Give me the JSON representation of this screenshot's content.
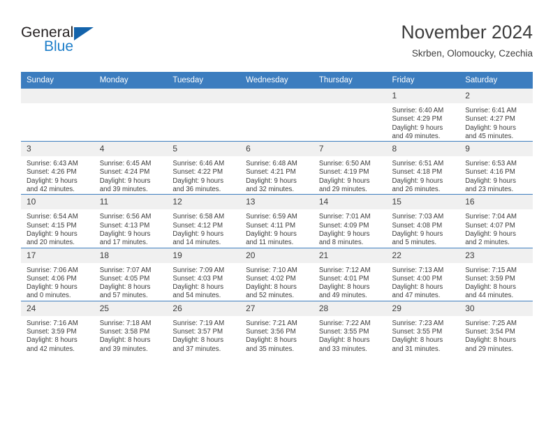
{
  "brand": {
    "name_part1": "General",
    "name_part2": "Blue"
  },
  "header": {
    "title": "November 2024",
    "subtitle": "Skrben, Olomoucky, Czechia"
  },
  "colors": {
    "header_blue": "#3c7dbf",
    "daynum_gray": "#f0f0f0",
    "logo_blue": "#1d7ec9",
    "text": "#3c3c3c"
  },
  "weekdays": [
    "Sunday",
    "Monday",
    "Tuesday",
    "Wednesday",
    "Thursday",
    "Friday",
    "Saturday"
  ],
  "weeks": [
    [
      {
        "day": "",
        "lines": []
      },
      {
        "day": "",
        "lines": []
      },
      {
        "day": "",
        "lines": []
      },
      {
        "day": "",
        "lines": []
      },
      {
        "day": "",
        "lines": []
      },
      {
        "day": "1",
        "lines": [
          "Sunrise: 6:40 AM",
          "Sunset: 4:29 PM",
          "Daylight: 9 hours",
          "and 49 minutes."
        ]
      },
      {
        "day": "2",
        "lines": [
          "Sunrise: 6:41 AM",
          "Sunset: 4:27 PM",
          "Daylight: 9 hours",
          "and 45 minutes."
        ]
      }
    ],
    [
      {
        "day": "3",
        "lines": [
          "Sunrise: 6:43 AM",
          "Sunset: 4:26 PM",
          "Daylight: 9 hours",
          "and 42 minutes."
        ]
      },
      {
        "day": "4",
        "lines": [
          "Sunrise: 6:45 AM",
          "Sunset: 4:24 PM",
          "Daylight: 9 hours",
          "and 39 minutes."
        ]
      },
      {
        "day": "5",
        "lines": [
          "Sunrise: 6:46 AM",
          "Sunset: 4:22 PM",
          "Daylight: 9 hours",
          "and 36 minutes."
        ]
      },
      {
        "day": "6",
        "lines": [
          "Sunrise: 6:48 AM",
          "Sunset: 4:21 PM",
          "Daylight: 9 hours",
          "and 32 minutes."
        ]
      },
      {
        "day": "7",
        "lines": [
          "Sunrise: 6:50 AM",
          "Sunset: 4:19 PM",
          "Daylight: 9 hours",
          "and 29 minutes."
        ]
      },
      {
        "day": "8",
        "lines": [
          "Sunrise: 6:51 AM",
          "Sunset: 4:18 PM",
          "Daylight: 9 hours",
          "and 26 minutes."
        ]
      },
      {
        "day": "9",
        "lines": [
          "Sunrise: 6:53 AM",
          "Sunset: 4:16 PM",
          "Daylight: 9 hours",
          "and 23 minutes."
        ]
      }
    ],
    [
      {
        "day": "10",
        "lines": [
          "Sunrise: 6:54 AM",
          "Sunset: 4:15 PM",
          "Daylight: 9 hours",
          "and 20 minutes."
        ]
      },
      {
        "day": "11",
        "lines": [
          "Sunrise: 6:56 AM",
          "Sunset: 4:13 PM",
          "Daylight: 9 hours",
          "and 17 minutes."
        ]
      },
      {
        "day": "12",
        "lines": [
          "Sunrise: 6:58 AM",
          "Sunset: 4:12 PM",
          "Daylight: 9 hours",
          "and 14 minutes."
        ]
      },
      {
        "day": "13",
        "lines": [
          "Sunrise: 6:59 AM",
          "Sunset: 4:11 PM",
          "Daylight: 9 hours",
          "and 11 minutes."
        ]
      },
      {
        "day": "14",
        "lines": [
          "Sunrise: 7:01 AM",
          "Sunset: 4:09 PM",
          "Daylight: 9 hours",
          "and 8 minutes."
        ]
      },
      {
        "day": "15",
        "lines": [
          "Sunrise: 7:03 AM",
          "Sunset: 4:08 PM",
          "Daylight: 9 hours",
          "and 5 minutes."
        ]
      },
      {
        "day": "16",
        "lines": [
          "Sunrise: 7:04 AM",
          "Sunset: 4:07 PM",
          "Daylight: 9 hours",
          "and 2 minutes."
        ]
      }
    ],
    [
      {
        "day": "17",
        "lines": [
          "Sunrise: 7:06 AM",
          "Sunset: 4:06 PM",
          "Daylight: 9 hours",
          "and 0 minutes."
        ]
      },
      {
        "day": "18",
        "lines": [
          "Sunrise: 7:07 AM",
          "Sunset: 4:05 PM",
          "Daylight: 8 hours",
          "and 57 minutes."
        ]
      },
      {
        "day": "19",
        "lines": [
          "Sunrise: 7:09 AM",
          "Sunset: 4:03 PM",
          "Daylight: 8 hours",
          "and 54 minutes."
        ]
      },
      {
        "day": "20",
        "lines": [
          "Sunrise: 7:10 AM",
          "Sunset: 4:02 PM",
          "Daylight: 8 hours",
          "and 52 minutes."
        ]
      },
      {
        "day": "21",
        "lines": [
          "Sunrise: 7:12 AM",
          "Sunset: 4:01 PM",
          "Daylight: 8 hours",
          "and 49 minutes."
        ]
      },
      {
        "day": "22",
        "lines": [
          "Sunrise: 7:13 AM",
          "Sunset: 4:00 PM",
          "Daylight: 8 hours",
          "and 47 minutes."
        ]
      },
      {
        "day": "23",
        "lines": [
          "Sunrise: 7:15 AM",
          "Sunset: 3:59 PM",
          "Daylight: 8 hours",
          "and 44 minutes."
        ]
      }
    ],
    [
      {
        "day": "24",
        "lines": [
          "Sunrise: 7:16 AM",
          "Sunset: 3:59 PM",
          "Daylight: 8 hours",
          "and 42 minutes."
        ]
      },
      {
        "day": "25",
        "lines": [
          "Sunrise: 7:18 AM",
          "Sunset: 3:58 PM",
          "Daylight: 8 hours",
          "and 39 minutes."
        ]
      },
      {
        "day": "26",
        "lines": [
          "Sunrise: 7:19 AM",
          "Sunset: 3:57 PM",
          "Daylight: 8 hours",
          "and 37 minutes."
        ]
      },
      {
        "day": "27",
        "lines": [
          "Sunrise: 7:21 AM",
          "Sunset: 3:56 PM",
          "Daylight: 8 hours",
          "and 35 minutes."
        ]
      },
      {
        "day": "28",
        "lines": [
          "Sunrise: 7:22 AM",
          "Sunset: 3:55 PM",
          "Daylight: 8 hours",
          "and 33 minutes."
        ]
      },
      {
        "day": "29",
        "lines": [
          "Sunrise: 7:23 AM",
          "Sunset: 3:55 PM",
          "Daylight: 8 hours",
          "and 31 minutes."
        ]
      },
      {
        "day": "30",
        "lines": [
          "Sunrise: 7:25 AM",
          "Sunset: 3:54 PM",
          "Daylight: 8 hours",
          "and 29 minutes."
        ]
      }
    ]
  ]
}
